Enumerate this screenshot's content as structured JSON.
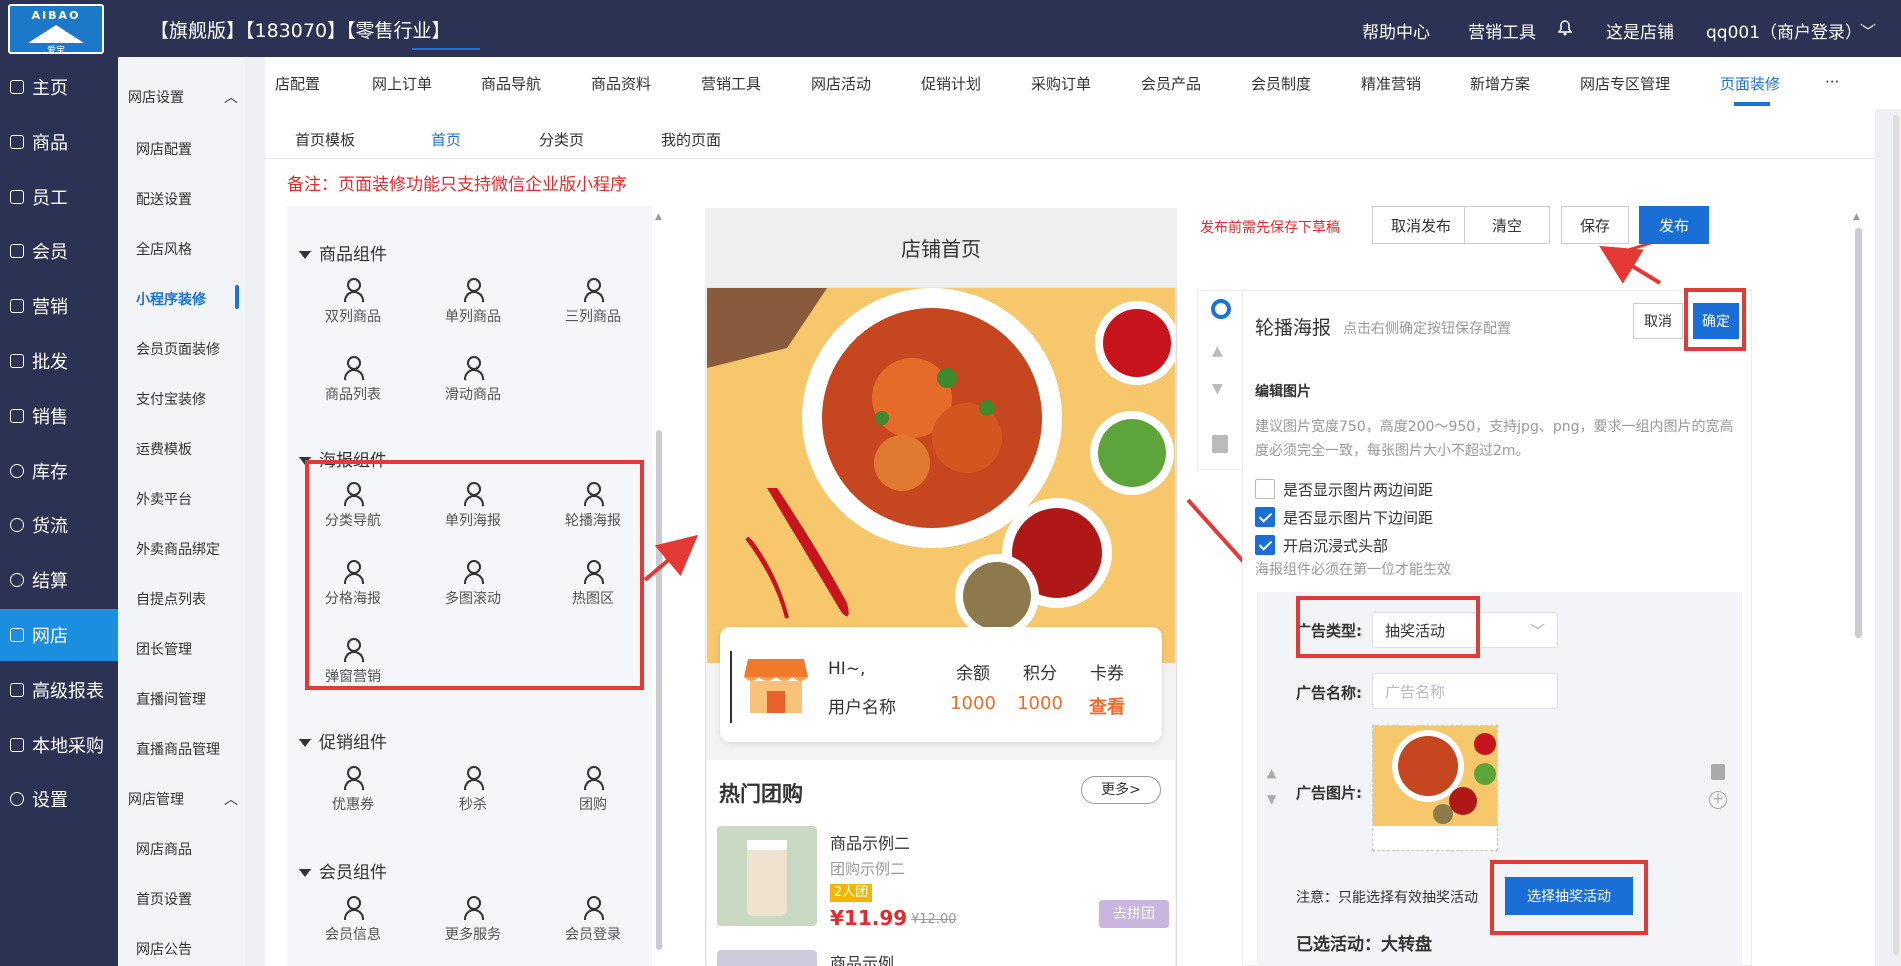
{
  "logo": {
    "top": "AIBAO",
    "bottom": "爱宝"
  },
  "header": {
    "store": "【旗舰版】【183070】【零售行业】",
    "help": "帮助中心",
    "marketing": "营销工具",
    "thisStore": "这是店铺",
    "user": "qq001（商户登录）"
  },
  "leftnav": [
    "主页",
    "商品",
    "员工",
    "会员",
    "营销",
    "批发",
    "销售",
    "库存",
    "货流",
    "结算",
    "网店",
    "高级报表",
    "本地采购",
    "设置"
  ],
  "subnav": {
    "group1": "网店设置",
    "items1": [
      "网店配置",
      "配送设置",
      "全店风格",
      "小程序装修",
      "会员页面装修",
      "支付宝装修",
      "运费模板",
      "外卖平台",
      "外卖商品绑定",
      "自提点列表",
      "团长管理",
      "直播间管理",
      "直播商品管理"
    ],
    "group2": "网店管理",
    "items2": [
      "网店商品",
      "首页设置",
      "网店公告"
    ]
  },
  "tabs": [
    "店配置",
    "网上订单",
    "商品导航",
    "商品资料",
    "营销工具",
    "网店活动",
    "促销计划",
    "采购订单",
    "会员产品",
    "会员制度",
    "精准营销",
    "新增方案",
    "网店专区管理",
    "页面装修",
    "···"
  ],
  "pageTabs": [
    "首页模板",
    "首页",
    "分类页",
    "我的页面"
  ],
  "notice": "备注：页面装修功能只支持微信企业版小程序",
  "components": {
    "g1": "商品组件",
    "g1items": [
      "双列商品",
      "单列商品",
      "三列商品",
      "商品列表",
      "滑动商品"
    ],
    "g2": "海报组件",
    "g2items": [
      "分类导航",
      "单列海报",
      "轮播海报",
      "分格海报",
      "多图滚动",
      "热图区",
      "弹窗营销"
    ],
    "g3": "促销组件",
    "g3items": [
      "优惠券",
      "秒杀",
      "团购"
    ],
    "g4": "会员组件",
    "g4items": [
      "会员信息",
      "更多服务",
      "会员登录"
    ]
  },
  "phone": {
    "title": "店铺首页",
    "greet": "HI~,",
    "username": "用户名称",
    "stats": [
      {
        "label": "余额",
        "value": "1000"
      },
      {
        "label": "积分",
        "value": "1000"
      },
      {
        "label": "卡券",
        "value": "查看"
      }
    ],
    "hotTitle": "热门团购",
    "more": "更多>",
    "product": {
      "name": "商品示例二",
      "sub": "团购示例二",
      "badge": "2人团",
      "price": "¥11.99",
      "old": "¥12.00",
      "btn": "去拼团"
    },
    "product2": "商品示例"
  },
  "actions": {
    "hint": "发布前需先保存下草稿",
    "unpublish": "取消发布",
    "clear": "清空",
    "save": "保存",
    "publish": "发布"
  },
  "editor": {
    "title": "轮播海报",
    "subtitle": "点击右侧确定按钮保存配置",
    "cancel": "取消",
    "confirm": "确定",
    "sectionTitle": "编辑图片",
    "tip": "建议图片宽度750，高度200～950，支持jpg、png，要求一组内图片的宽高度必须完全一致，每张图片大小不超过2m。",
    "checks": [
      {
        "label": "是否显示图片两边间距",
        "on": false
      },
      {
        "label": "是否显示图片下边间距",
        "on": true
      },
      {
        "label": "开启沉浸式头部",
        "on": true
      }
    ],
    "immersiveNote": "海报组件必须在第一位才能生效",
    "adTypeLabel": "广告类型:",
    "adType": "抽奖活动",
    "adNameLabel": "广告名称:",
    "adNamePlaceholder": "广告名称",
    "adImageLabel": "广告图片:",
    "note": "注意：只能选择有效抽奖活动",
    "selectBtn": "选择抽奖活动",
    "selected": "已选活动：大转盘"
  },
  "colors": {
    "navy": "#2c3253",
    "accent": "#1a73d9",
    "red": "#e53935",
    "orange": "#ee6c2a"
  }
}
